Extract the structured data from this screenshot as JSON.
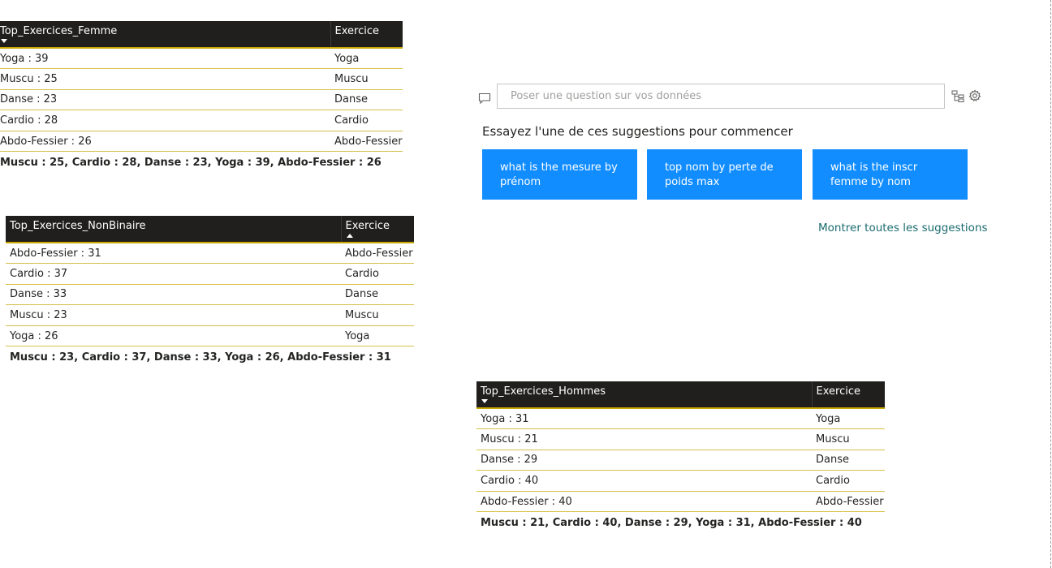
{
  "tables": {
    "femme": {
      "header": [
        "Top_Exercices_Femme",
        "Exercice"
      ],
      "rows": [
        [
          "Yoga : 39",
          "Yoga"
        ],
        [
          "Muscu : 25",
          "Muscu"
        ],
        [
          "Danse : 23",
          "Danse"
        ],
        [
          "Cardio : 28",
          "Cardio"
        ],
        [
          "Abdo-Fessier : 26",
          "Abdo-Fessier"
        ]
      ],
      "total": "Muscu : 25, Cardio : 28, Danse : 23, Yoga : 39, Abdo-Fessier : 26"
    },
    "nonbinaire": {
      "header": [
        "Top_Exercices_NonBinaire",
        "Exercice"
      ],
      "rows": [
        [
          "Abdo-Fessier : 31",
          "Abdo-Fessier"
        ],
        [
          "Cardio : 37",
          "Cardio"
        ],
        [
          "Danse : 33",
          "Danse"
        ],
        [
          "Muscu : 23",
          "Muscu"
        ],
        [
          "Yoga : 26",
          "Yoga"
        ]
      ],
      "total": "Muscu : 23, Cardio : 37, Danse : 33, Yoga : 26, Abdo-Fessier : 31"
    },
    "hommes": {
      "header": [
        "Top_Exercices_Hommes",
        "Exercice"
      ],
      "rows": [
        [
          "Yoga : 31",
          "Yoga"
        ],
        [
          "Muscu : 21",
          "Muscu"
        ],
        [
          "Danse : 29",
          "Danse"
        ],
        [
          "Cardio : 40",
          "Cardio"
        ],
        [
          "Abdo-Fessier : 40",
          "Abdo-Fessier"
        ]
      ],
      "total": "Muscu : 21, Cardio : 40, Danse : 29, Yoga : 31, Abdo-Fessier : 40"
    }
  },
  "qa": {
    "placeholder": "Poser une question sur vos données",
    "heading": "Essayez l'une de ces suggestions pour commencer",
    "suggestions": [
      "what is the mesure by prénom",
      "top nom by perte de poids max",
      "what is the inscr femme by nom"
    ],
    "show_all": "Montrer toutes les suggestions"
  },
  "icons": {
    "chat": "chat-bubble-icon",
    "hierarchy": "hierarchy-icon",
    "settings": "gear-icon"
  },
  "colors": {
    "header_bg": "#201f1e",
    "accent_line": "#c8a800",
    "suggestion_bg": "#118dff",
    "link": "#1a6b6f"
  }
}
